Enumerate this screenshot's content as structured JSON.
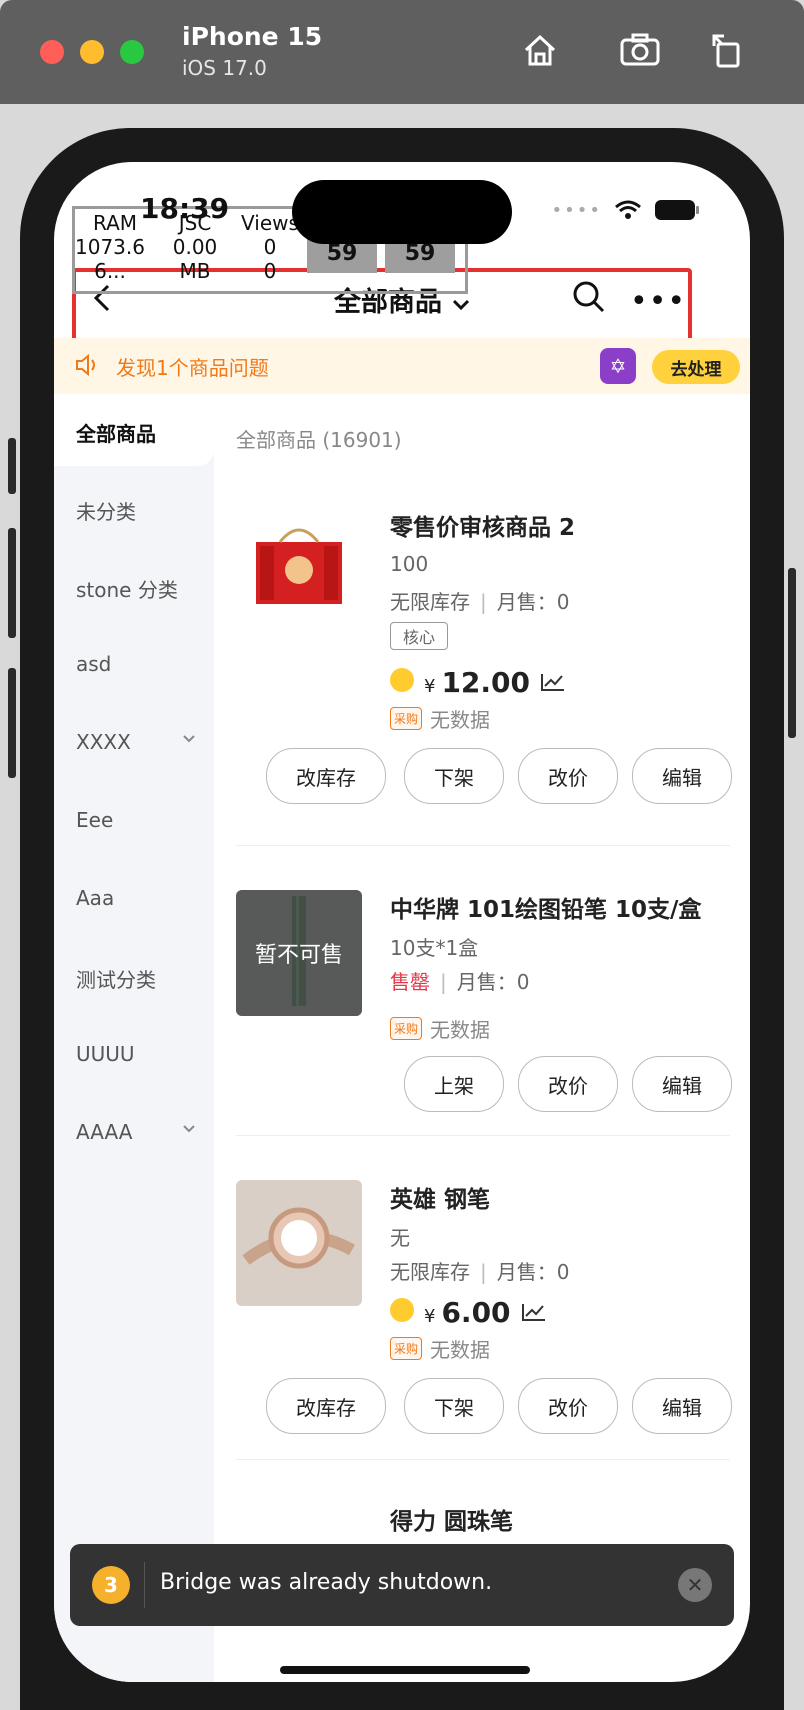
{
  "simulator": {
    "device": "iPhone 15",
    "os": "iOS 17.0"
  },
  "status": {
    "time": "18:39"
  },
  "perf": {
    "ram_label": "RAM",
    "ram_value": "1073.6",
    "ram_unit": "6...",
    "jsc_label": "JSC",
    "jsc_value": "0.00",
    "jsc_unit": "MB",
    "views_label": "Views",
    "views_value": "0",
    "views_value2": "0",
    "fps1": "59",
    "fps2": "59"
  },
  "nav": {
    "title": "全部商品"
  },
  "notice": {
    "text": "发现1个商品问题",
    "action": "去处理"
  },
  "sidebar": {
    "items": [
      {
        "label": "全部商品"
      },
      {
        "label": "未分类"
      },
      {
        "label": "stone 分类"
      },
      {
        "label": "asd"
      },
      {
        "label": "XXXX"
      },
      {
        "label": "Eee"
      },
      {
        "label": "Aaa"
      },
      {
        "label": "测试分类"
      },
      {
        "label": "UUUU"
      },
      {
        "label": "AAAA"
      }
    ]
  },
  "content": {
    "header": "全部商品 (16901)"
  },
  "products": [
    {
      "title": "零售价审核商品 2",
      "spec": "100",
      "stock": "无限库存",
      "sales": "月售：0",
      "tag": "核心",
      "currency": "¥",
      "price": "12.00",
      "purchase_badge": "采购",
      "purchase": "无数据",
      "buttons": [
        "改库存",
        "下架",
        "改价",
        "编辑"
      ]
    },
    {
      "title": "中华牌 101绘图铅笔 10支/盒",
      "spec": "10支*1盒",
      "stock": "售罄",
      "sales": "月售：0",
      "overlay": "暂不可售",
      "purchase_badge": "采购",
      "purchase": "无数据",
      "buttons": [
        "上架",
        "改价",
        "编辑"
      ]
    },
    {
      "title": "英雄 钢笔",
      "spec": "无",
      "stock": "无限库存",
      "sales": "月售：0",
      "currency": "¥",
      "price": "6.00",
      "purchase_badge": "采购",
      "purchase": "无数据",
      "buttons": [
        "改库存",
        "下架",
        "改价",
        "编辑"
      ]
    },
    {
      "title": "得力 圆珠笔"
    }
  ],
  "toast": {
    "count": "3",
    "message": "Bridge was already shutdown."
  }
}
